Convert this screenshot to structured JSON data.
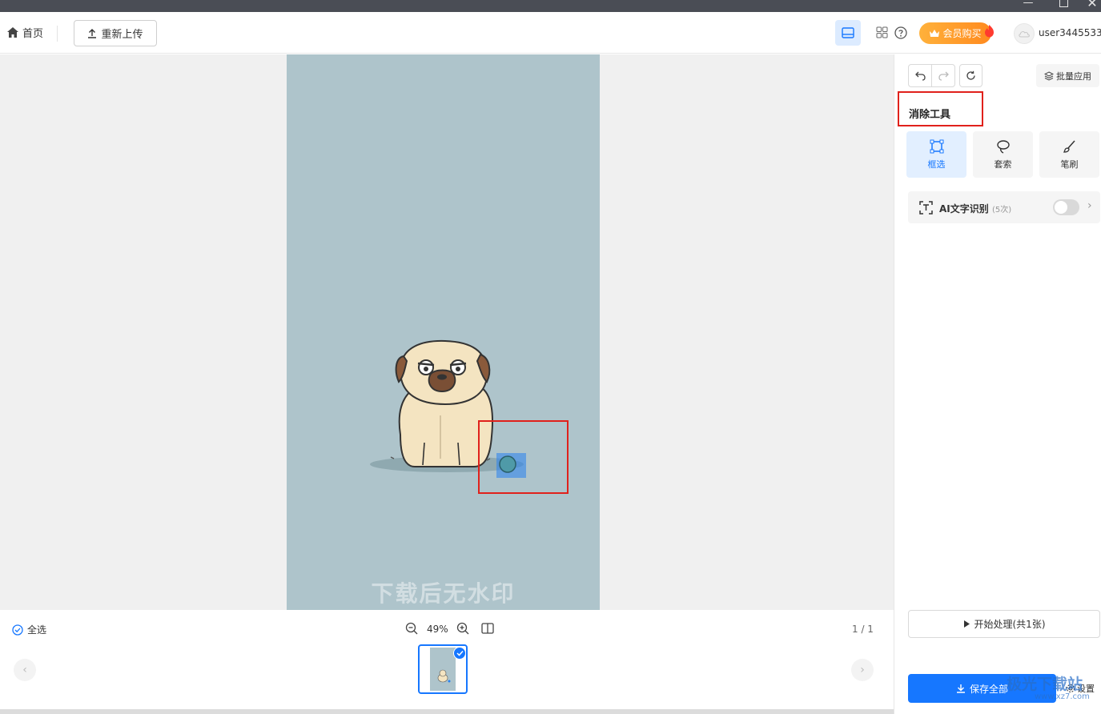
{
  "titlebar": {
    "minimize": "—",
    "close": "✕"
  },
  "toolbar": {
    "home_label": "首页",
    "reupload_label": "重新上传",
    "vip_label": "会员购买",
    "username": "user3445533"
  },
  "canvas": {
    "image_watermark": "下载后无水印"
  },
  "bottom": {
    "select_all_label": "全选",
    "zoom_level": "49%",
    "page_count": "1 / 1",
    "prev": "‹",
    "next": "›"
  },
  "panel": {
    "batch_label": "批量应用",
    "tool_title": "消除工具",
    "tools": [
      {
        "label": "框选",
        "active": true
      },
      {
        "label": "套索",
        "active": false
      },
      {
        "label": "笔刷",
        "active": false
      }
    ],
    "ocr_label": "AI文字识别",
    "ocr_count": "(5次)",
    "ocr_enabled": false,
    "ocr_chevron": "›",
    "start_label": "开始处理(共1张)",
    "save_label": "保存全部",
    "settings_label": "设置",
    "site_watermark": "极光下载站",
    "site_url": "www.xz7.com"
  },
  "colors": {
    "accent": "#1677ff",
    "highlight_red": "#e0211b",
    "canvas_bg": "#aec4cb",
    "vip_orange": "#ff8a1f"
  }
}
